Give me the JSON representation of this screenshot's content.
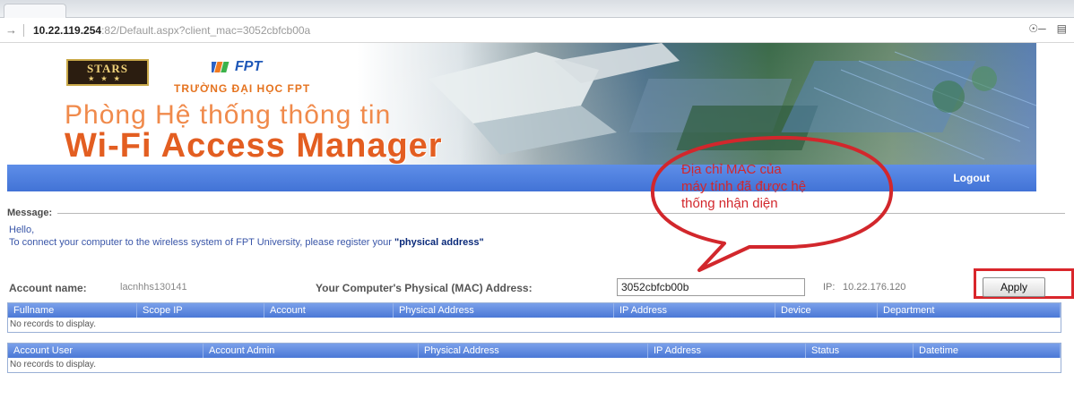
{
  "browser": {
    "url_host": "10.22.119.254",
    "url_rest": ":82/Default.aspx?client_mac=3052cbfcb00a",
    "icons": [
      "key-icon",
      "page-icon"
    ]
  },
  "banner": {
    "stars_label": "STARS",
    "fpt_label": "FPT",
    "school_name": "TRƯỜNG ĐẠI HỌC FPT",
    "title_line1": "Phòng Hệ thống thông tin",
    "title_line2": "Wi-Fi Access Manager"
  },
  "nav": {
    "logout_label": "Logout"
  },
  "message": {
    "legend": "Message:",
    "hello": "Hello,",
    "body_prefix": "To connect your computer to the wireless system of FPT University, please register your ",
    "body_emphasis": "\"physical address\""
  },
  "account": {
    "name_label": "Account name:",
    "name_value": "lacnhhs130141",
    "mac_label": "Your Computer's Physical (MAC) Address:",
    "mac_value": "3052cbfcb00b",
    "ip_label": "IP:",
    "ip_value": "10.22.176.120",
    "apply_label": "Apply"
  },
  "grid1": {
    "columns": [
      "Fullname",
      "Scope IP",
      "Account",
      "Physical Address",
      "IP Address",
      "Device",
      "Department"
    ],
    "empty_text": "No records to display."
  },
  "grid2": {
    "columns": [
      "Account User",
      "Account Admin",
      "Physical Address",
      "IP Address",
      "Status",
      "Datetime"
    ],
    "empty_text": "No records to display."
  },
  "annotation": {
    "lines": [
      "Địa chỉ MAC của",
      "máy tính đã được hệ",
      "thống nhận diện"
    ],
    "color": "#d2272c"
  },
  "colors": {
    "nav_blue": "#4a78d6",
    "accent_orange": "#e35e21",
    "highlight_red": "#d9262b"
  }
}
